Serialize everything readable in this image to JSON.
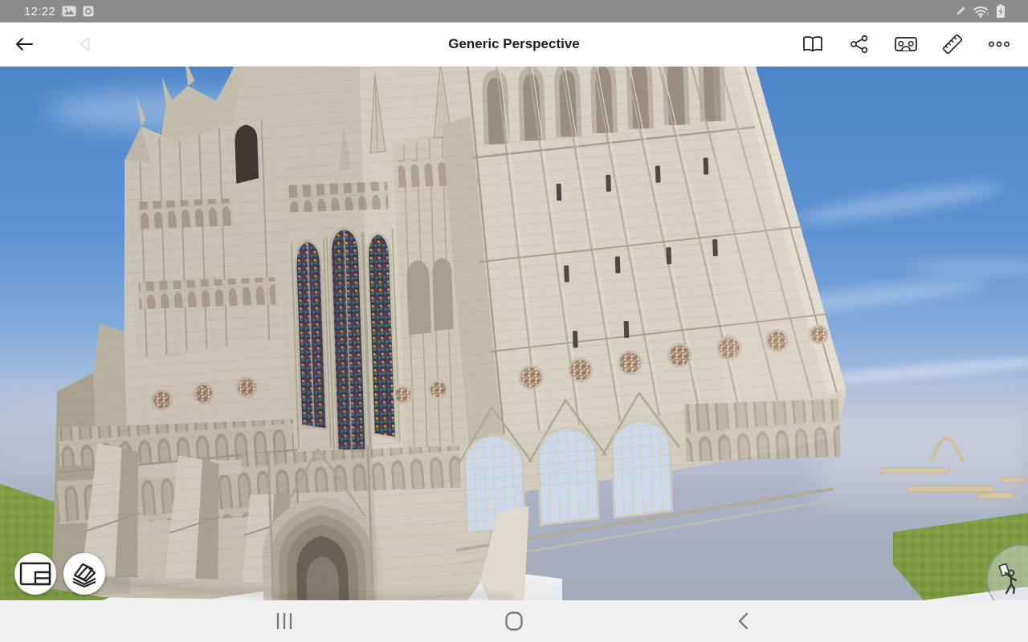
{
  "status_bar": {
    "time": "12:22",
    "left_icons": [
      "image-notification-icon",
      "screen-record-notification-icon"
    ],
    "right_icons": [
      "stylus-icon",
      "wifi-icon",
      "battery-charging-icon"
    ],
    "bg_color": "#8b8b8b"
  },
  "toolbar": {
    "title": "Generic Perspective",
    "left_icons": [
      "back-arrow-icon",
      "previous-view-icon"
    ],
    "right_icons": [
      "bookmarks-icon",
      "share-icon",
      "vr-cardboard-icon",
      "measure-icon",
      "more-options-icon"
    ],
    "bg_color": "#ffffff",
    "title_color": "#1d1d1d"
  },
  "scene": {
    "subject": "gothic-cathedral-3d-model",
    "colors": {
      "sky_top": "#4c86c9",
      "sky_low": "#9db9dd",
      "haze": "#b9c3d5",
      "ground": "#a8aec0",
      "grass": "#7d9c42",
      "stone_light": "#d8d2c3",
      "stone_shadow": "#b4ac9a",
      "stone_dark": "#8e8676",
      "stained_glass": "#37508f",
      "glass_pale": "#c9d7e6",
      "pavement": "#eef0f2",
      "distant_sand": "#d8c7a0"
    }
  },
  "floating_buttons": {
    "left": [
      {
        "name": "layout-sheets-button",
        "icon": "layout-sheet-icon"
      },
      {
        "name": "sheet-stack-button",
        "icon": "sheet-stack-icon"
      }
    ],
    "right": {
      "name": "walk-mode-button",
      "icon": "walking-person-icon"
    }
  },
  "nav_bar": {
    "icons": [
      "recent-apps-icon",
      "home-icon",
      "back-icon"
    ],
    "bg_color": "#f1f1f1",
    "icon_color": "#7b7b7b"
  }
}
